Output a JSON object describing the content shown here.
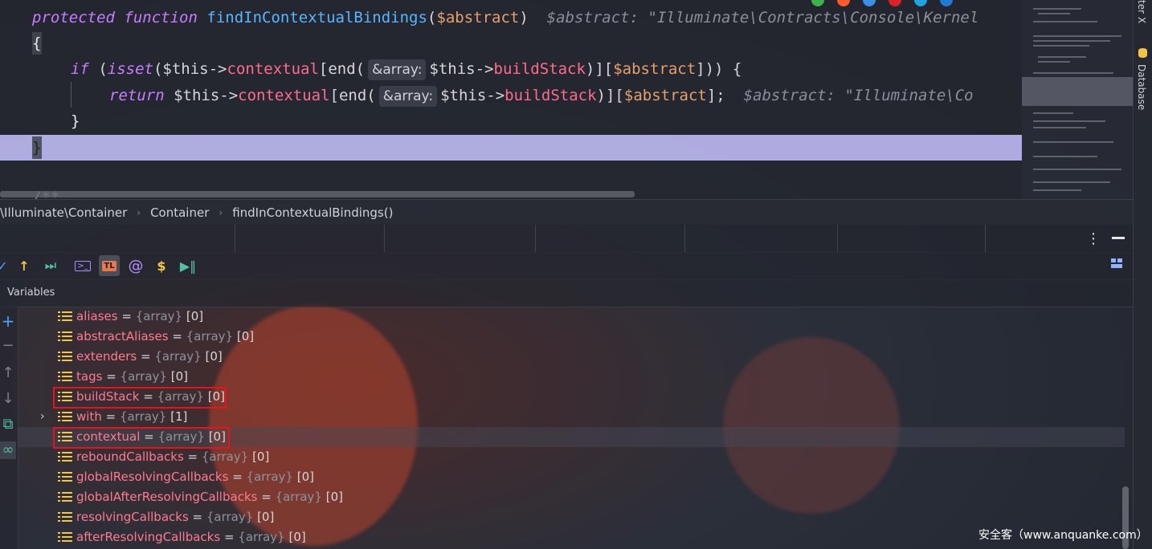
{
  "editor": {
    "line1": {
      "kw1": "protected",
      "kw2": "function",
      "fn": "findInContextualBindings",
      "open": "(",
      "param": "$abstract",
      "close": ")",
      "hint": "$abstract: \"Illuminate\\Contracts\\Console\\Kernel"
    },
    "line2": {
      "brace": "{"
    },
    "line3": {
      "kw": "if",
      "p1": " (",
      "fn": "isset",
      "p2": "($this->",
      "prop": "contextual",
      "p3": "[end(",
      "hint_label": "&array:",
      "p4": "$this->",
      "prop2": "buildStack",
      "p5": ")][",
      "var": "$abstract",
      "p6": "])) {"
    },
    "line4": {
      "kw": "return",
      "p1": " $this->",
      "prop": "contextual",
      "p2": "[end(",
      "hint_label": "&array:",
      "p3": "$this->",
      "prop2": "buildStack",
      "p4": ")][",
      "var": "$abstract",
      "p5": "];",
      "hint": "$abstract: \"Illuminate\\Co"
    },
    "line5": {
      "brace": "}"
    },
    "line6": {
      "brace": "}"
    },
    "line8": {
      "text": "/**"
    }
  },
  "right_strip": {
    "label1": "ter X",
    "label2": "Database"
  },
  "breadcrumb": {
    "items": [
      "\\Illuminate\\Container",
      "Container",
      "findInContextualBindings()"
    ],
    "separator": "›"
  },
  "toolbar": {
    "more": "⋮",
    "console_label": ">_",
    "tl_label": "TL",
    "at_label": "@",
    "dollar_label": "$"
  },
  "variables_panel": {
    "title": "Variables",
    "rows": [
      {
        "name": "aliases",
        "eq": " = ",
        "type": "{array}",
        "count": " [0]"
      },
      {
        "name": "abstractAliases",
        "eq": " = ",
        "type": "{array}",
        "count": " [0]"
      },
      {
        "name": "extenders",
        "eq": " = ",
        "type": "{array}",
        "count": " [0]"
      },
      {
        "name": "tags",
        "eq": " = ",
        "type": "{array}",
        "count": " [0]"
      },
      {
        "name": "buildStack",
        "eq": " = ",
        "type": "{array}",
        "count": " [0]"
      },
      {
        "name": "with",
        "eq": " = ",
        "type": "{array}",
        "count": " [1]"
      },
      {
        "name": "contextual",
        "eq": " = ",
        "type": "{array}",
        "count": " [0]"
      },
      {
        "name": "reboundCallbacks",
        "eq": " = ",
        "type": "{array}",
        "count": " [0]"
      },
      {
        "name": "globalResolvingCallbacks",
        "eq": " = ",
        "type": "{array}",
        "count": " [0]"
      },
      {
        "name": "globalAfterResolvingCallbacks",
        "eq": " = ",
        "type": "{array}",
        "count": " [0]"
      },
      {
        "name": "resolvingCallbacks",
        "eq": " = ",
        "type": "{array}",
        "count": " [0]"
      },
      {
        "name": "afterResolvingCallbacks",
        "eq": " = ",
        "type": "{array}",
        "count": " [0]"
      }
    ]
  },
  "watermark": "安全客（www.anquanke.com）",
  "colors": {
    "highlight_box": "#e4141b",
    "variable_name": "#ff7a8f",
    "list_icon": "#f0c548",
    "current_line": "#c8c3ff"
  }
}
